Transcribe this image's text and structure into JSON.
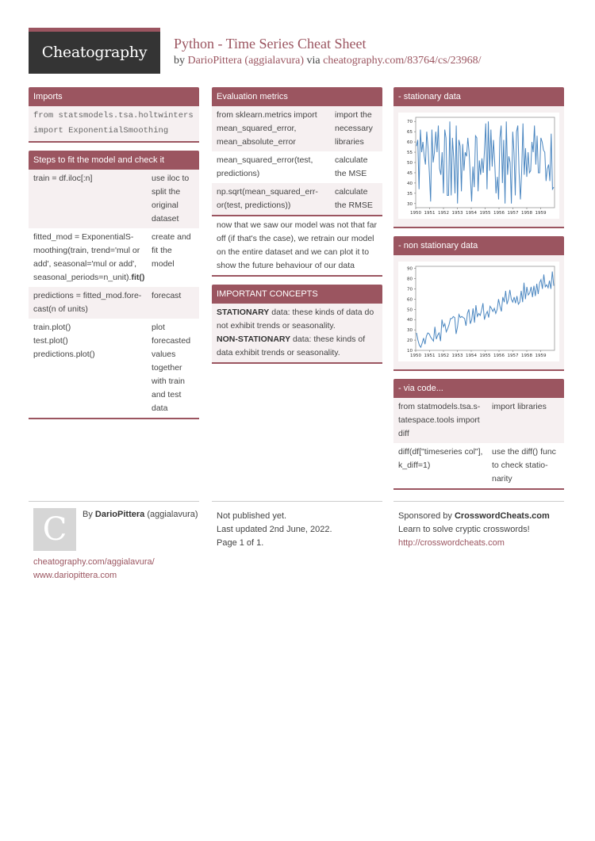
{
  "header": {
    "logo": "Cheatography",
    "title": "Python - Time Series Cheat Sheet",
    "by_prefix": "by",
    "author": "DarioPittera (aggialavura)",
    "via": "via",
    "url": "cheatography.com/83764/cs/23968/"
  },
  "imports": {
    "title": "Imports",
    "lines": [
      "from statsmodels.tsa.holtwinters",
      "import ExponentialSmoothing"
    ]
  },
  "steps": {
    "title": "Steps to fit the model and check it",
    "rows": [
      {
        "code": "train = df.iloc[:n]",
        "desc": "use iloc to split the original dataset"
      },
      {
        "code": "fitted_mod = ExponentialS-moothing(train, trend='mul or add', seasonal='mul or add', seasonal_periods=n_unit).",
        "code_bold": "fit()",
        "desc": "create and fit the model"
      },
      {
        "code": "predictions = fitted_mod.fore-cast(n of units)",
        "desc": "forecast"
      },
      {
        "code": "train.plot()\ntest.plot()\npredictions.plot()",
        "desc": "plot forecasted values together with train and test data"
      }
    ]
  },
  "metrics": {
    "title": "Evaluation metrics",
    "rows": [
      {
        "code": "from sklearn.metrics import mean_squared_error, mean_absolute_error",
        "desc": "import the necessary libraries"
      },
      {
        "code": "mean_squared_error(test, predictions)",
        "desc": "calculate the MSE"
      },
      {
        "code": "np.sqrt(mean_squared_err-or(test, predictions))",
        "desc": "calculate the RMSE"
      }
    ],
    "note": "now that we saw our model was not that far off (if that's the case), we retrain our model on the entire dataset and we can plot it to show the future behaviour of our data"
  },
  "concepts": {
    "title": "IMPORTANT CONCEPTS",
    "s_bold": "STATIONARY",
    "s_text": " data: these kinds of data do not exhibit trends or seasonality.",
    "n_bold": "NON-STATIONARY",
    "n_text": " data: these kinds of data exhibit trends or seasonality."
  },
  "stationary": {
    "title": "- stationary data"
  },
  "nonstationary": {
    "title": "- non stationary data"
  },
  "viacode": {
    "title": "- via code...",
    "rows": [
      {
        "code": "from statmodels.tsa.s-tatespace.tools import diff",
        "desc": "import libraries"
      },
      {
        "code": "diff(df[\"timeseries col\"], k_diff=1)",
        "desc": "use the diff() func to check statio-narity"
      }
    ]
  },
  "footer": {
    "avatar_letter": "C",
    "by": "By",
    "author_name": "DarioPittera",
    "author_handle": "(aggialavura)",
    "link1": "cheatography.com/aggialavura/",
    "link2": "www.dariopittera.com",
    "published": "Not published yet.",
    "updated": "Last updated 2nd June, 2022.",
    "page": "Page 1 of 1.",
    "sponsored_prefix": "Sponsored by",
    "sponsor": "CrosswordCheats.com",
    "sponsor_tagline": "Learn to solve cryptic crosswords!",
    "sponsor_url": "http://crosswordcheats.com"
  },
  "colors": {
    "accent": "#9b5560",
    "line": "#4a86c0",
    "logo_bg": "#343434"
  },
  "chart_data": [
    {
      "type": "line",
      "title": "",
      "xlabel": "",
      "ylabel": "",
      "xlim": [
        1950,
        1960
      ],
      "ylim": [
        28,
        72
      ],
      "xticks": [
        "1950",
        "1951",
        "1952",
        "1953",
        "1954",
        "1955",
        "1956",
        "1957",
        "1958",
        "1959"
      ],
      "yticks": [
        30,
        35,
        40,
        45,
        50,
        55,
        60,
        65,
        70
      ],
      "series": [
        {
          "name": "stationary",
          "values": [
            58,
            61,
            37,
            66,
            55,
            60,
            53,
            49,
            65,
            57,
            45,
            31,
            66,
            50,
            55,
            65,
            55,
            68,
            47,
            44,
            55,
            35,
            66,
            62,
            34,
            34,
            70,
            34,
            62,
            52,
            35,
            68,
            30,
            61,
            58,
            36,
            59,
            46,
            55,
            53,
            62,
            55,
            43,
            31,
            48,
            38,
            63,
            62,
            36,
            51,
            44,
            52,
            45,
            56,
            69,
            37,
            70,
            46,
            66,
            48,
            61,
            50,
            35,
            43,
            32,
            62,
            68,
            40,
            61,
            30,
            70,
            44,
            53,
            50,
            30,
            65,
            55,
            34,
            65,
            68,
            45,
            32,
            46,
            69,
            44,
            57,
            43,
            55,
            45,
            46,
            60,
            55,
            68,
            49,
            63,
            45,
            45,
            62,
            60,
            56,
            55,
            41,
            47,
            49,
            41,
            64,
            37,
            38
          ]
        }
      ]
    },
    {
      "type": "line",
      "title": "",
      "xlabel": "",
      "ylabel": "",
      "xlim": [
        1950,
        1960
      ],
      "ylim": [
        10,
        92
      ],
      "xticks": [
        "1950",
        "1951",
        "1952",
        "1953",
        "1954",
        "1955",
        "1956",
        "1957",
        "1958",
        "1959"
      ],
      "yticks": [
        10,
        20,
        30,
        40,
        50,
        60,
        70,
        80,
        90
      ],
      "series": [
        {
          "name": "non stationary",
          "values": [
            27,
            20,
            15,
            13,
            17,
            22,
            16,
            24,
            27,
            26,
            23,
            21,
            19,
            33,
            21,
            25,
            27,
            19,
            40,
            33,
            36,
            28,
            31,
            35,
            41,
            41,
            43,
            42,
            26,
            33,
            45,
            42,
            43,
            42,
            41,
            34,
            46,
            50,
            36,
            40,
            51,
            37,
            54,
            43,
            46,
            44,
            49,
            56,
            40,
            45,
            48,
            42,
            53,
            51,
            48,
            51,
            46,
            50,
            60,
            53,
            48,
            62,
            57,
            68,
            55,
            60,
            69,
            60,
            57,
            62,
            56,
            63,
            55,
            57,
            68,
            57,
            76,
            60,
            72,
            64,
            66,
            72,
            62,
            73,
            63,
            75,
            65,
            76,
            79,
            70,
            84,
            72,
            74,
            71,
            78,
            70,
            87,
            73
          ]
        }
      ]
    }
  ]
}
